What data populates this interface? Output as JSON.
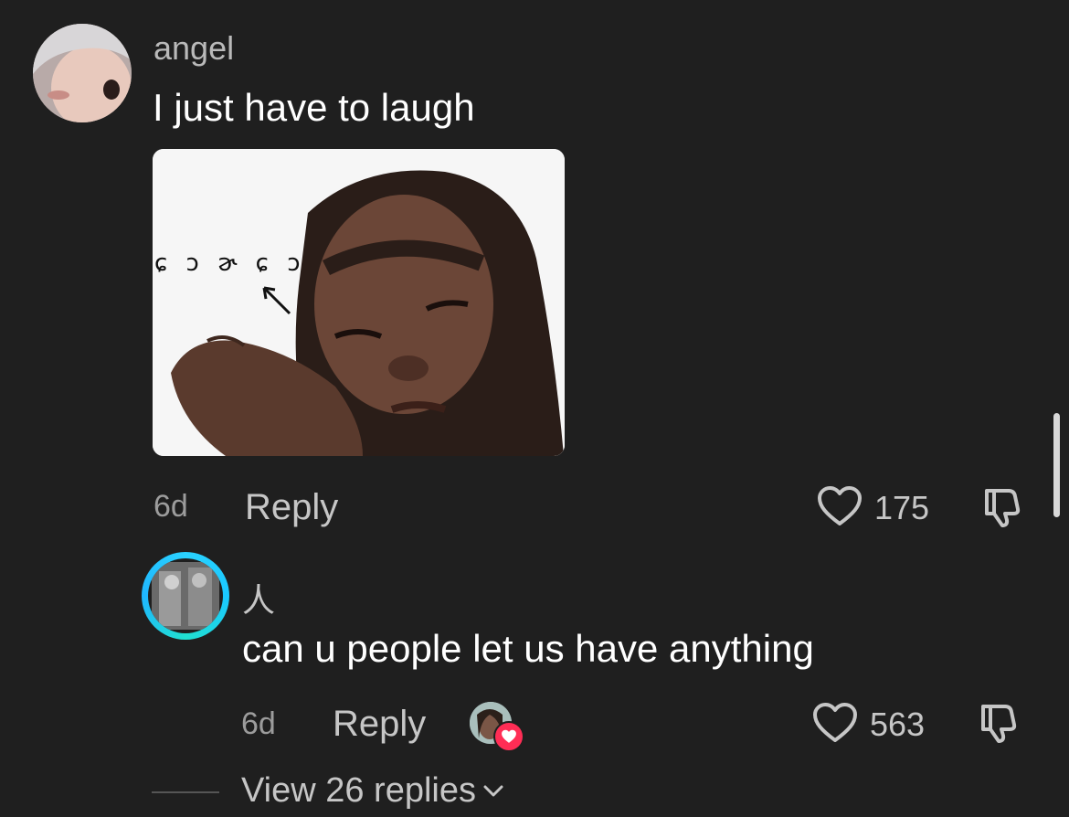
{
  "comments": [
    {
      "username": "angel",
      "text": "I just have to laugh",
      "attachment": {
        "type": "image",
        "caption": "ɕ ɔ ɚ ɕ ɔ"
      },
      "time": "6d",
      "reply_label": "Reply",
      "likes": "175",
      "like_icon": "heart-outline-icon",
      "dislike_icon": "thumbs-down-icon"
    },
    {
      "username": "人",
      "text": "can u people let us have anything",
      "time": "6d",
      "reply_label": "Reply",
      "likes": "563",
      "liked_by_creator": true,
      "like_icon": "heart-outline-icon",
      "dislike_icon": "thumbs-down-icon",
      "view_replies": "View 26 replies",
      "view_replies_icon": "chevron-down-icon"
    }
  ],
  "colors": {
    "background": "#1f1f1f",
    "text_primary": "#ffffff",
    "text_secondary": "#c6c6c6",
    "story_ring": "#2ad2ff",
    "heart_badge": "#ff2d55"
  }
}
